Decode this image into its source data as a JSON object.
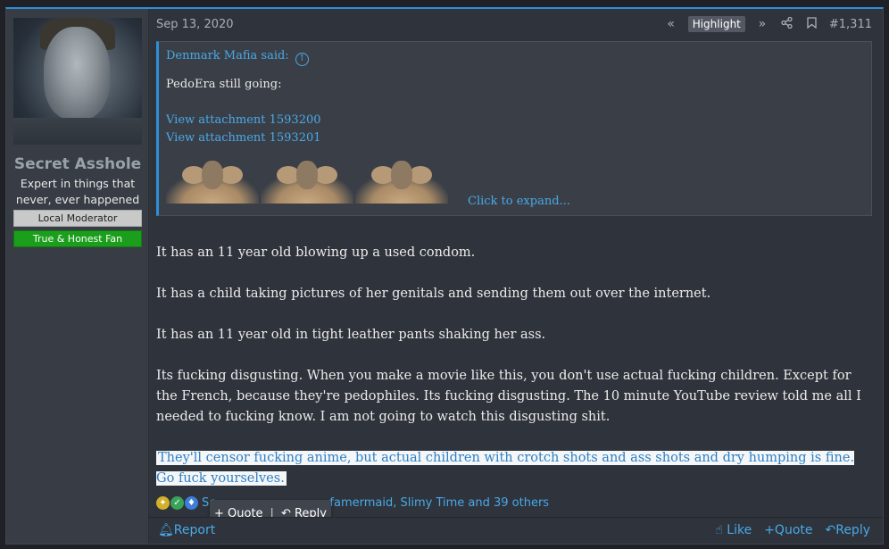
{
  "user": {
    "name": "Secret Asshole",
    "title": "Expert in things that never, ever happened",
    "banner_mod": "Local Moderator",
    "banner_fan": "True & Honest Fan"
  },
  "header": {
    "date": "Sep 13, 2020",
    "highlight": "Highlight",
    "post_number": "#1,311"
  },
  "quote": {
    "author": "Denmark Mafia said:",
    "line": "PedoEra still going:",
    "attachment1": "View attachment 1593200",
    "attachment2": "View attachment 1593201",
    "expand": "Click to expand..."
  },
  "content": {
    "p1": "It has an 11 year old blowing up a used condom.",
    "p2": "It has a child taking pictures of her genitals and sending them out over the internet.",
    "p3": "It has an 11 year old in tight leather pants shaking her ass.",
    "p4": "Its fucking disgusting. When you make a movie like this, you don't use actual fucking children. Except for the French, because they're pedophiles. Its fucking disgusting. The 10 minute YouTube review told me all I needed to fucking know. I am not going to watch this disgusting shit.",
    "p5": "They'll censor fucking anime, but actual children with crotch shots and ass shots and dry humping is fine. Go fuck yourselves."
  },
  "reactions": {
    "text_start": "Sc",
    "text_end": "famermaid, Slimy Time and 39 others"
  },
  "popup": {
    "quote": "+ Quote",
    "sep": "|",
    "reply": "Reply"
  },
  "footer": {
    "report": "Report",
    "like": "Like",
    "quote": "Quote",
    "reply": "Reply"
  },
  "colors": {
    "accent": "#2f8fd6",
    "link": "#49a9e8",
    "post_bg": "#2f333b",
    "fan_banner": "#1b9e1b"
  }
}
